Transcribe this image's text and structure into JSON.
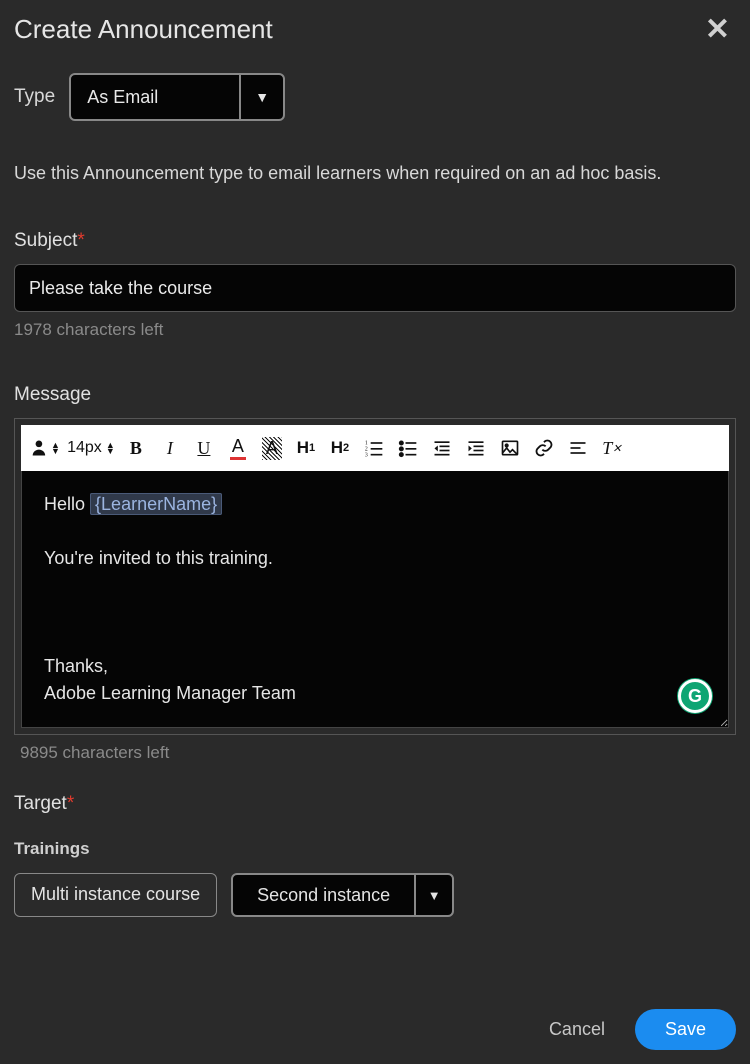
{
  "header": {
    "title": "Create Announcement"
  },
  "type": {
    "label": "Type",
    "value": "As Email"
  },
  "description": "Use this Announcement type to email learners when required on an ad hoc basis.",
  "subject": {
    "label": "Subject",
    "value": "Please take the course",
    "chars_left": "1978 characters left"
  },
  "message": {
    "label": "Message",
    "font_size": "14px",
    "body": {
      "greeting_prefix": "Hello ",
      "token": "{LearnerName}",
      "invite": "You're invited to this training.",
      "thanks": "Thanks,",
      "signature": "Adobe Learning Manager Team"
    },
    "chars_left": "9895 characters left"
  },
  "target": {
    "label": "Target",
    "trainings_label": "Trainings",
    "chip": "Multi instance course",
    "instance": "Second instance"
  },
  "footer": {
    "cancel": "Cancel",
    "save": "Save"
  }
}
